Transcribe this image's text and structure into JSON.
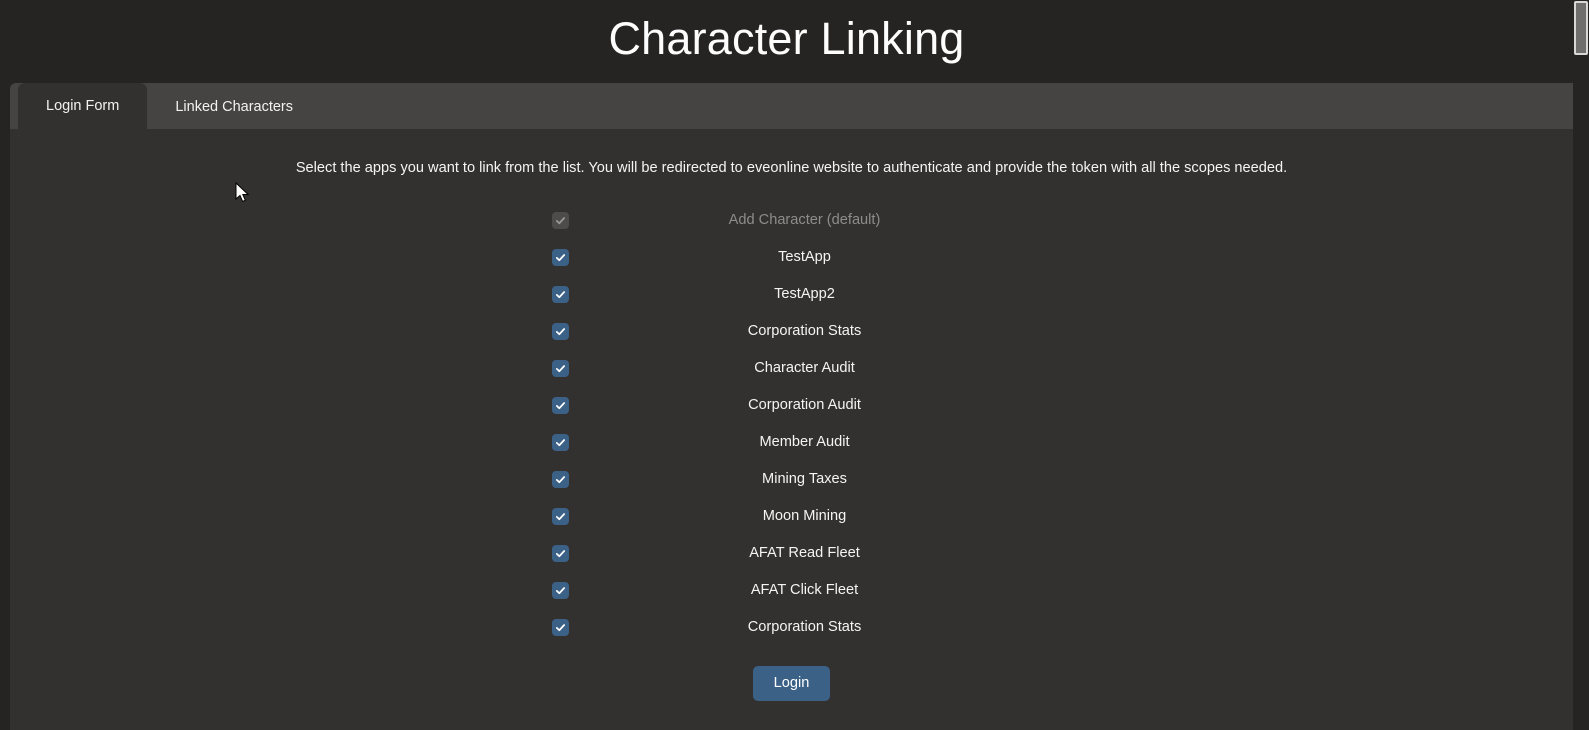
{
  "header": {
    "title": "Character Linking"
  },
  "tabs": [
    {
      "label": "Login Form",
      "active": true
    },
    {
      "label": "Linked Characters",
      "active": false
    }
  ],
  "main": {
    "instructions": "Select the apps you want to link from the list. You will be redirected to eveonline website to authenticate and provide the token with all the scopes needed.",
    "apps": [
      {
        "label": "Add Character (default)",
        "checked": true,
        "disabled": true
      },
      {
        "label": "TestApp",
        "checked": true,
        "disabled": false
      },
      {
        "label": "TestApp2",
        "checked": true,
        "disabled": false
      },
      {
        "label": "Corporation Stats",
        "checked": true,
        "disabled": false
      },
      {
        "label": "Character Audit",
        "checked": true,
        "disabled": false
      },
      {
        "label": "Corporation Audit",
        "checked": true,
        "disabled": false
      },
      {
        "label": "Member Audit",
        "checked": true,
        "disabled": false
      },
      {
        "label": "Mining Taxes",
        "checked": true,
        "disabled": false
      },
      {
        "label": "Moon Mining",
        "checked": true,
        "disabled": false
      },
      {
        "label": "AFAT Read Fleet",
        "checked": true,
        "disabled": false
      },
      {
        "label": "AFAT Click Fleet",
        "checked": true,
        "disabled": false
      },
      {
        "label": "Corporation Stats",
        "checked": true,
        "disabled": false
      }
    ],
    "login_label": "Login"
  },
  "colors": {
    "page_background": "#262423",
    "panel_background": "#333130",
    "tabstrip_background": "#454443",
    "accent_blue": "#3b6187",
    "disabled_gray": "#4e4c4b",
    "muted_text": "#8e8c8b",
    "text": "#f4f4f4"
  }
}
